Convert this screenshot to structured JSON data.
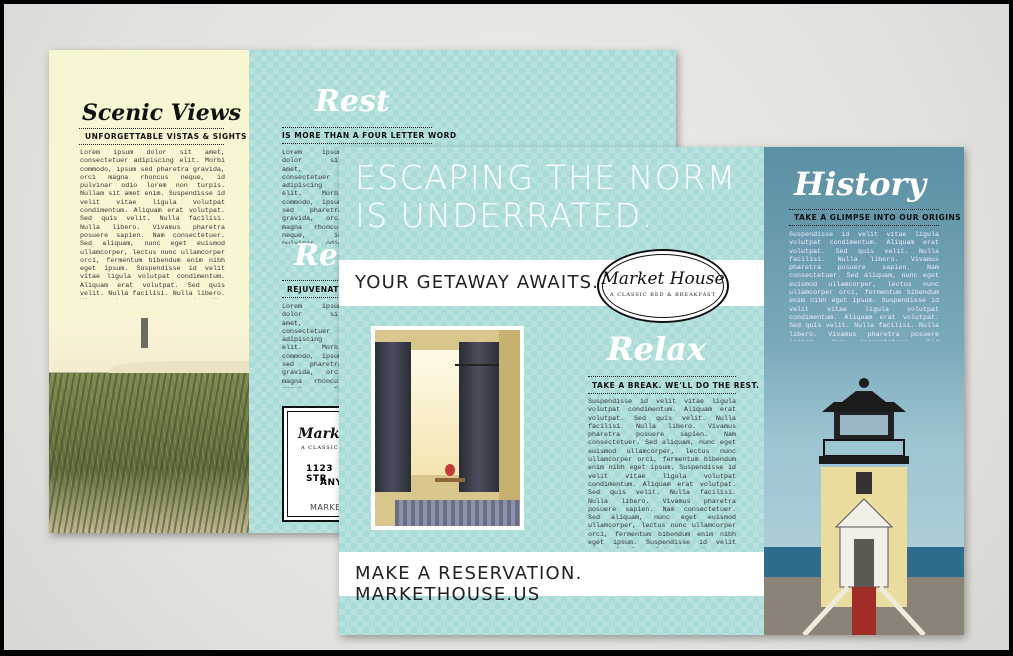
{
  "back": {
    "scenic": {
      "title": "Scenic Views",
      "caption": "UNFORGETTABLE VISTAS & SIGHTS",
      "body": "Lorem ipsum dolor sit amet, consectetuer adipiscing elit. Morbi commodo, ipsum sed pharetra gravida, orci magna rhoncus neque, id pulvinar odio lorem non turpis. Nullam sit amet enim. Suspendisse id velit vitae ligula volutpat condimentum. Aliquam erat volutpat. Sed quis velit. Nulla facilisi. Nulla libero. Vivamus pharetra posuere sapien. Nam consectetuer. Sed aliquam, nunc eget euismod ullamcorper, lectus nunc ullamcorper orci, fermentum bibendum enim nibh eget ipsum. Suspendisse id velit vitae ligula volutpat condimentum. Aliquam erat volutpat. Sed quis velit. Nulla facilisi. Nulla libero. Vivamus pharetra posuere sapien. Nam consectetuer. Sed aliquam, nunc eget euismod ullamcorper, lectus nunc ullamcorper orci, fermentum bibendum enim nibh eget ipsum."
    },
    "rest": {
      "title": "Rest",
      "caption": "IS MORE THAN A FOUR LETTER WORD",
      "body": "Lorem ipsum dolor sit amet, consectetuer adipiscing elit. Morbi commodo, ipsum sed pharetra gravida, orci magna rhoncus neque, id pulvinar odio lorem non turpis. Nullam sit amet enim. Suspendisse id velit vitae ligula volutpat condimentum. Aliquam erat volutpat. Sed quis velit. Nulla facilisi. Nulla libero. Vivamus pharetra posuere sapien. Nam consectetuer. Sed aliquam, nunc eget euismod ullamcorper, lectus nunc ullamcorper orci, fermentum bibendum enim nibh eget ipsum. Nullam sit amet enim. Suspendisse id velit vitae ligula volutpat condimentum."
    },
    "rejuv": {
      "title": "Re",
      "caption": "REJUVENATE Y",
      "body": "Lorem ipsum dolor sit amet, consectetuer adipiscing elit. Morbi commodo, ipsum sed pharetra gravida, orci magna rhoncus neque, id pulvinar odio lorem non turpis. Nullam sit amet enim. Suspendisse id velit vitae ligula volutpat condimentum. Aliquam erat volutpat. Sed quis velit. Nulla facilisi. Nulla libero."
    },
    "card": {
      "name": "Marke",
      "sub": "A CLASSIC",
      "addr1": "1123 STR",
      "addr2": "ANY",
      "web": "MARKE"
    }
  },
  "front": {
    "headline_1": "ESCAPING THE NORM",
    "headline_2": "IS UNDERRATED.",
    "getaway": "YOUR GETAWAY AWAITS.",
    "logo_name": "Market House",
    "logo_sub": "A CLASSIC BED & BREAKFAST",
    "relax": {
      "title": "Relax",
      "caption": "TAKE A BREAK.  WE'LL DO THE REST.",
      "body": "Suspendisse id velit vitae ligula volutpat condimentum. Aliquam erat volutpat. Sed quis velit. Nulla facilisi. Nulla libero. Vivamus pharetra posuere sapien. Nam consectetuer. Sed aliquam, nunc eget euismod ullamcorper, lectus nunc ullamcorper orci, fermentum bibendum enim nibh eget ipsum. Suspendisse id velit vitae ligula volutpat condimentum. Aliquam erat volutpat. Sed quis velit. Nulla facilisi. Nulla libero. Vivamus pharetra posuere sapien. Nam consectetuer. Sed aliquam, nunc eget euismod ullamcorper, lectus nunc ullamcorper orci, fermentum bibendum enim nibh eget ipsum. Suspendisse id velit vitae ligula volutpat condimentum. Aliquam erat volutpat. Sed quis velit. Nulla facilisi. Nulla libero. Vivamus pharetra posuere sapien. Nam consectetuer."
    },
    "reservation": "MAKE A RESERVATION.  MARKETHOUSE.US",
    "history": {
      "title": "History",
      "caption": "TAKE A GLIMPSE INTO OUR ORIGINS",
      "body": "Suspendisse id velit vitae ligula volutpat condimentum. Aliquam erat volutpat. Sed quis velit. Nulla facilisi. Nulla libero. Vivamus pharetra posuere sapien. Nam consectetuer. Sed aliquam, nunc eget euismod ullamcorper, lectus nunc ullamcorper orci, fermentum bibendum enim nibh eget ipsum. Suspendisse id velit vitae ligula volutpat condimentum. Aliquam erat volutpat. Sed quis velit. Nulla facilisi. Nulla libero. Vivamus pharetra posuere sapien. Nam consectetuer. Sed aliquam, nunc eget euismod ullamcorper, lectus nunc ullamcorper orci, fermentum bibendum enim nibh eget ipsum."
    }
  },
  "colors": {
    "teal": "#a9dcd8",
    "cream": "#f8f6d2",
    "sky": "#5b8fa3"
  }
}
